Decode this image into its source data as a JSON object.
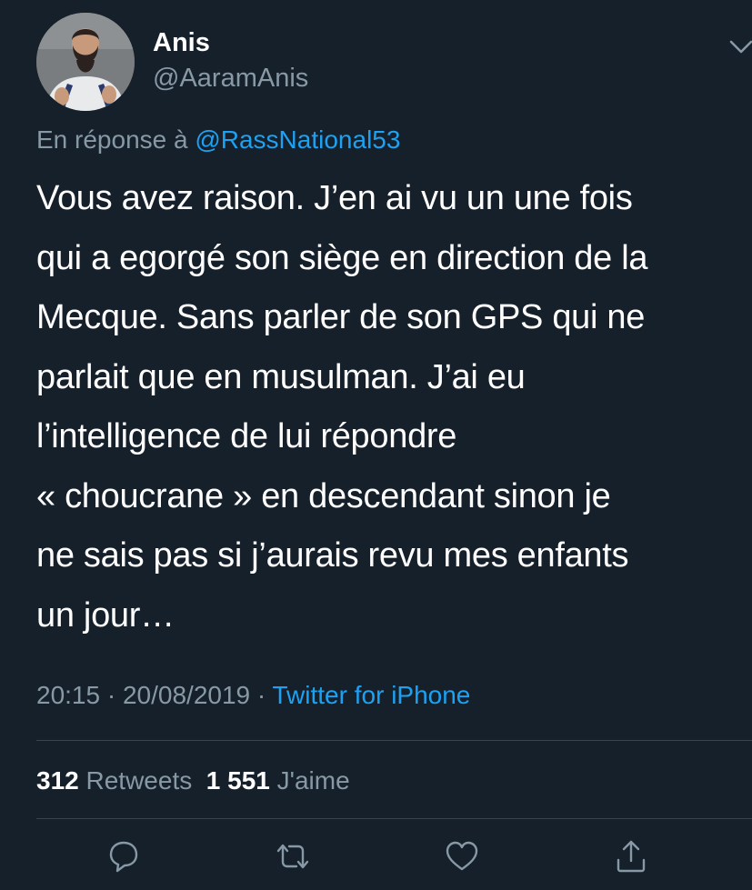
{
  "user": {
    "display_name": "Anis",
    "handle": "@AaramAnis",
    "avatar_icon": "profile-photo"
  },
  "reply": {
    "prefix": "En réponse à ",
    "mention": "@RassNational53"
  },
  "tweet": {
    "lines": [
      "Vous avez raison. J’en ai vu un une fois",
      "qui a egorgé son siège en direction de la",
      "Mecque. Sans parler de son GPS qui ne",
      "parlait que en musulman. J’ai eu",
      "l’intelligence de lui répondre",
      "« choucrane » en descendant sinon je",
      "ne sais pas si j’aurais revu mes enfants",
      "un jour…"
    ]
  },
  "meta": {
    "time": "20:15",
    "separator1": " · ",
    "date": "20/08/2019",
    "separator2": " · ",
    "source": "Twitter for iPhone"
  },
  "stats": {
    "retweets_count": "312",
    "retweets_label": "Retweets",
    "likes_count": "1 551",
    "likes_label": "J'aime"
  },
  "actions": {
    "icons": [
      "reply-icon",
      "retweet-icon",
      "like-icon",
      "share-icon"
    ]
  },
  "colors": {
    "background": "#15202b",
    "text": "#ffffff",
    "secondary": "#8899a6",
    "accent": "#1da1f2",
    "divider": "#38444d"
  }
}
